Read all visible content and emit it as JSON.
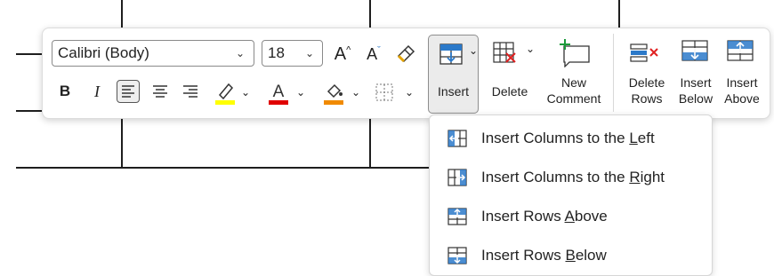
{
  "toolbar": {
    "font_name": "Calibri (Body)",
    "font_size": "18",
    "buttons": {
      "bold": "B",
      "italic": "I",
      "font_color": "A",
      "grow": "A",
      "shrink": "A"
    },
    "insert_label": "Insert",
    "delete_label": "Delete",
    "new_comment_label_1": "New",
    "new_comment_label_2": "Comment",
    "delete_rows_1": "Delete",
    "delete_rows_2": "Rows",
    "insert_below_1": "Insert",
    "insert_below_2": "Below",
    "insert_above_1": "Insert",
    "insert_above_2": "Above"
  },
  "menu": {
    "items": [
      {
        "pre": "Insert Columns to the ",
        "key": "L",
        "post": "eft",
        "icon": "insert-columns-left-icon"
      },
      {
        "pre": "Insert Columns to the ",
        "key": "R",
        "post": "ight",
        "icon": "insert-columns-right-icon"
      },
      {
        "pre": "Insert Rows ",
        "key": "A",
        "post": "bove",
        "icon": "insert-rows-above-icon"
      },
      {
        "pre": "Insert Rows ",
        "key": "B",
        "post": "elow",
        "icon": "insert-rows-below-icon"
      }
    ]
  },
  "colors": {
    "highlight": "#ffff00",
    "font_color": "#e00000",
    "shading": "#f08a00",
    "accent_blue": "#2b79c9",
    "accent_green": "#1a9a3a",
    "delete_red": "#e02020"
  }
}
